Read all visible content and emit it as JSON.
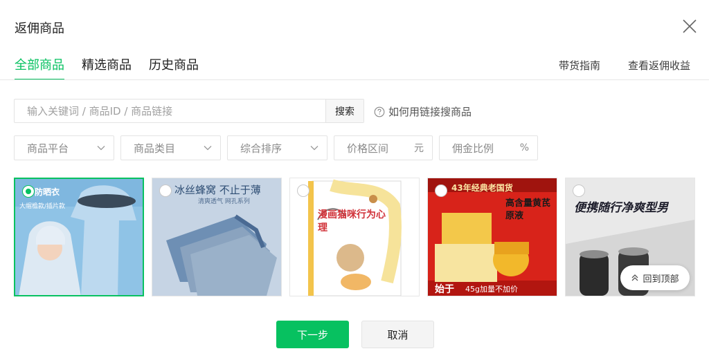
{
  "dialog": {
    "title": "返佣商品"
  },
  "tabs": [
    {
      "label": "全部商品",
      "active": true
    },
    {
      "label": "精选商品",
      "active": false
    },
    {
      "label": "历史商品",
      "active": false
    }
  ],
  "top_links": [
    {
      "label": "带货指南"
    },
    {
      "label": "查看返佣收益"
    }
  ],
  "search": {
    "placeholder": "输入关键词 / 商品ID / 商品链接",
    "value": "",
    "button_label": "搜索",
    "help_label": "如何用链接搜商品"
  },
  "filters": [
    {
      "label": "商品平台",
      "type": "select"
    },
    {
      "label": "商品类目",
      "type": "select"
    },
    {
      "label": "综合排序",
      "type": "select"
    },
    {
      "label": "价格区间",
      "type": "input",
      "unit": "元"
    },
    {
      "label": "佣金比例",
      "type": "input",
      "unit": "%"
    }
  ],
  "products": [
    {
      "selected": true,
      "headline": "防晒衣",
      "subline": "大帽檐款/插片款"
    },
    {
      "selected": false,
      "headline": "冰丝蜂窝 不止于薄",
      "subline": "清爽透气 网孔系列"
    },
    {
      "selected": false,
      "headline": "漫画猫咪行为心理",
      "subline": ""
    },
    {
      "selected": false,
      "headline": "43年经典老国货",
      "subline": "高含量黄芪原液",
      "badge": "45g加量不加价",
      "corner": "始于"
    },
    {
      "selected": false,
      "headline": "便携随行净爽型男",
      "subline": ""
    }
  ],
  "back_to_top": {
    "label": "回到顶部"
  },
  "footer": {
    "next_label": "下一步",
    "cancel_label": "取消"
  },
  "colors": {
    "accent": "#07c160",
    "text": "#1f1f1f",
    "muted": "#8a8a8a",
    "border": "#e3e3e3"
  },
  "icons": {
    "close": "close-icon",
    "help": "question-circle-icon",
    "dropdown": "chevron-down-icon",
    "back_top": "double-chevron-up-icon"
  }
}
